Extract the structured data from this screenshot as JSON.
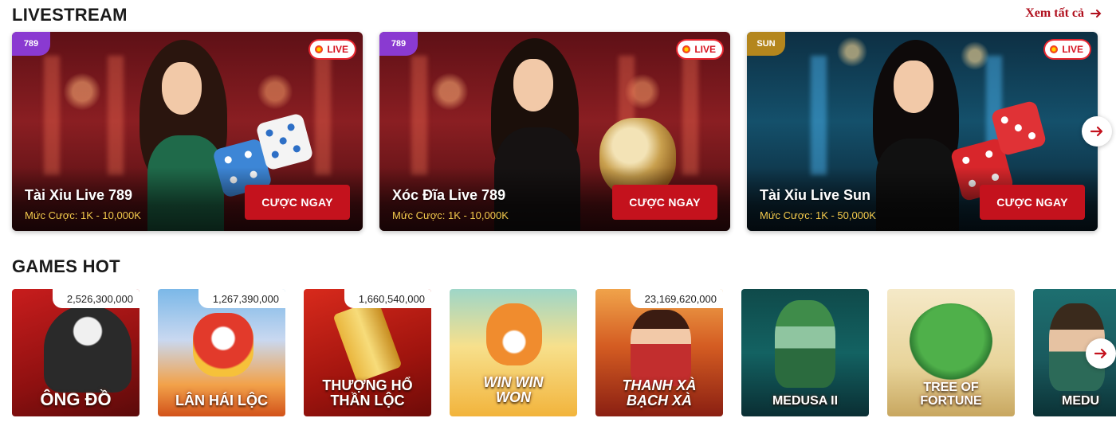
{
  "livestream": {
    "heading": "LIVESTREAM",
    "see_all": "Xem tất cả",
    "cards": [
      {
        "logo": "789",
        "badge": "LIVE",
        "title": "Tài Xỉu Live 789",
        "bet": "Mức Cược: 1K - 10,000K",
        "button": "CƯỢC NGAY"
      },
      {
        "logo": "789",
        "badge": "LIVE",
        "title": "Xóc Đĩa Live 789",
        "bet": "Mức Cược: 1K - 10,000K",
        "button": "CƯỢC NGAY"
      },
      {
        "logo": "SUN",
        "badge": "LIVE",
        "title": "Tài Xỉu Live Sun",
        "bet": "Mức Cược: 1K - 50,000K",
        "button": "CƯỢC NGAY"
      }
    ]
  },
  "games_hot": {
    "heading": "GAMES HOT",
    "games": [
      {
        "name": "ÔNG ĐỒ",
        "jackpot": "2,526,300,000"
      },
      {
        "name": "LÂN HÁI LỘC",
        "jackpot": "1,267,390,000"
      },
      {
        "name": "THƯỢNG HỔ\nTHẦN LỘC",
        "jackpot": "1,660,540,000"
      },
      {
        "name": "WIN WIN\nWON",
        "jackpot": ""
      },
      {
        "name": "THANH XÀ\nBẠCH XÀ",
        "jackpot": "23,169,620,000"
      },
      {
        "name": "MEDUSA II",
        "jackpot": ""
      },
      {
        "name": "TREE OF\nFORTUNE",
        "jackpot": ""
      },
      {
        "name": "MEDU",
        "jackpot": ""
      }
    ]
  },
  "icons": {
    "next": "arrow-right-icon",
    "see_all": "arrow-right-icon",
    "live": "live-dot-icon"
  },
  "colors": {
    "accent": "#c4121d",
    "bet_text": "#f2c94c",
    "see_all": "#b0101e"
  }
}
